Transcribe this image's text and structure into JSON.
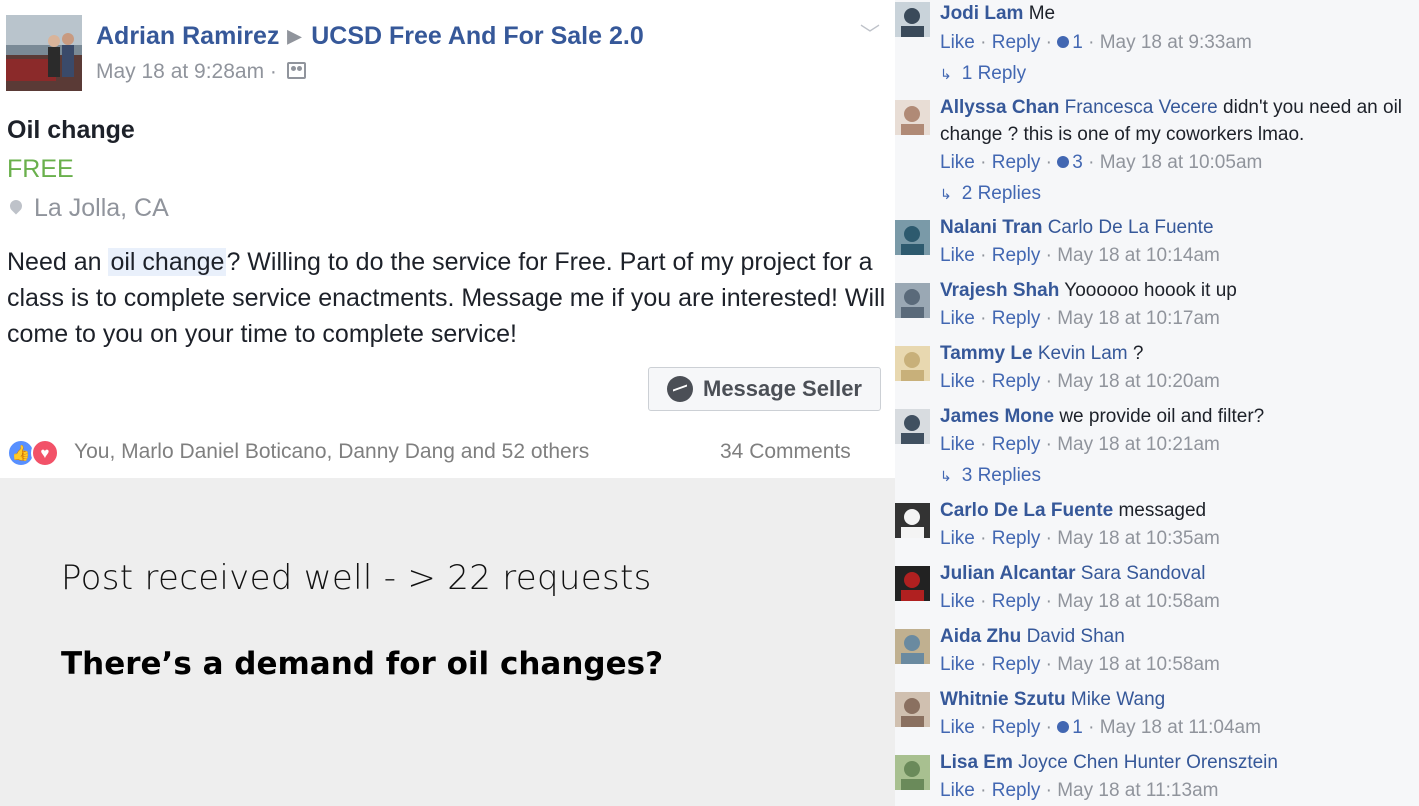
{
  "post": {
    "author": "Adrian Ramirez",
    "group": "UCSD Free And For Sale 2.0",
    "timestamp": "May 18 at 9:28am",
    "audience_icon": "group-audience-icon",
    "item_title": "Oil change",
    "price": "FREE",
    "location": "La Jolla, CA",
    "description_pre": "Need an ",
    "description_highlight": "oil change",
    "description_post": "? Willing to do the service for Free. Part of my project for a class is to complete service enactments. Message me if you are interested! Will come to you on your time to complete service!",
    "message_button": "Message Seller",
    "reactions_text": "You, Marlo Daniel Boticano, Danny Dang and 52 others",
    "comments_count": "34 Comments",
    "colors": {
      "link": "#365899",
      "price": "#6ab04c",
      "meta": "#90949c"
    }
  },
  "slide": {
    "line1": "Post received well - > 22 requests",
    "line2": "There’s a demand for oil changes?"
  },
  "comments": [
    {
      "name": "Jodi Lam",
      "tag": "",
      "text": "Me",
      "like": "Like",
      "reply": "Reply",
      "count": "1",
      "time": "May 18 at 9:33am",
      "replies": "1 Reply"
    },
    {
      "name": "Allyssa Chan",
      "tag": "Francesca Vecere",
      "text": "didn't you need an oil change ? this is one of my coworkers lmao.",
      "like": "Like",
      "reply": "Reply",
      "count": "3",
      "time": "May 18 at 10:05am",
      "replies": "2 Replies"
    },
    {
      "name": "Nalani Tran",
      "tag": "Carlo De La Fuente",
      "text": "",
      "like": "Like",
      "reply": "Reply",
      "count": "",
      "time": "May 18 at 10:14am",
      "replies": ""
    },
    {
      "name": "Vrajesh Shah",
      "tag": "",
      "text": "Yoooooo hoook it up",
      "like": "Like",
      "reply": "Reply",
      "count": "",
      "time": "May 18 at 10:17am",
      "replies": ""
    },
    {
      "name": "Tammy Le",
      "tag": "Kevin Lam",
      "text": "?",
      "like": "Like",
      "reply": "Reply",
      "count": "",
      "time": "May 18 at 10:20am",
      "replies": ""
    },
    {
      "name": "James Mone",
      "tag": "",
      "text": "we provide oil and filter?",
      "like": "Like",
      "reply": "Reply",
      "count": "",
      "time": "May 18 at 10:21am",
      "replies": "3 Replies"
    },
    {
      "name": "Carlo De La Fuente",
      "tag": "",
      "text": "messaged",
      "like": "Like",
      "reply": "Reply",
      "count": "",
      "time": "May 18 at 10:35am",
      "replies": ""
    },
    {
      "name": "Julian Alcantar",
      "tag": "Sara Sandoval",
      "text": "",
      "like": "Like",
      "reply": "Reply",
      "count": "",
      "time": "May 18 at 10:58am",
      "replies": ""
    },
    {
      "name": "Aida Zhu",
      "tag": "David Shan",
      "text": "",
      "like": "Like",
      "reply": "Reply",
      "count": "",
      "time": "May 18 at 10:58am",
      "replies": ""
    },
    {
      "name": "Whitnie Szutu",
      "tag": "Mike Wang",
      "text": "",
      "like": "Like",
      "reply": "Reply",
      "count": "1",
      "time": "May 18 at 11:04am",
      "replies": ""
    },
    {
      "name": "Lisa Em",
      "tag": "Joyce Chen Hunter Orensztein",
      "text": "",
      "like": "Like",
      "reply": "Reply",
      "count": "",
      "time": "May 18 at 11:13am",
      "replies": ""
    }
  ]
}
